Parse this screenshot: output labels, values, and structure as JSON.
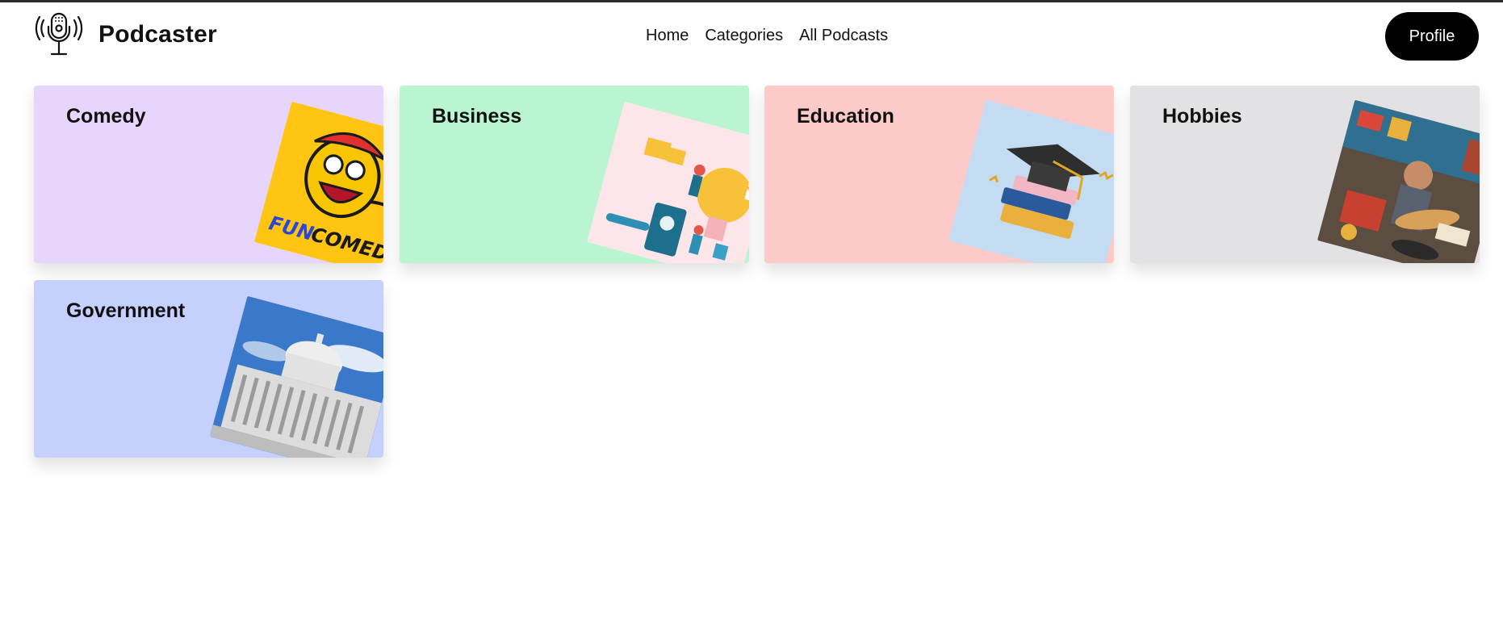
{
  "header": {
    "brand": "Podcaster",
    "nav": [
      "Home",
      "Categories",
      "All Podcasts"
    ],
    "profile_label": "Profile"
  },
  "categories": [
    {
      "name": "Comedy",
      "color": "#e8d5fb",
      "art_text": "FUN COMEDY"
    },
    {
      "name": "Business",
      "color": "#b9f5d1"
    },
    {
      "name": "Education",
      "color": "#fdcaca"
    },
    {
      "name": "Hobbies",
      "color": "#e2e2e4"
    },
    {
      "name": "Government",
      "color": "#c6d0fd"
    }
  ]
}
